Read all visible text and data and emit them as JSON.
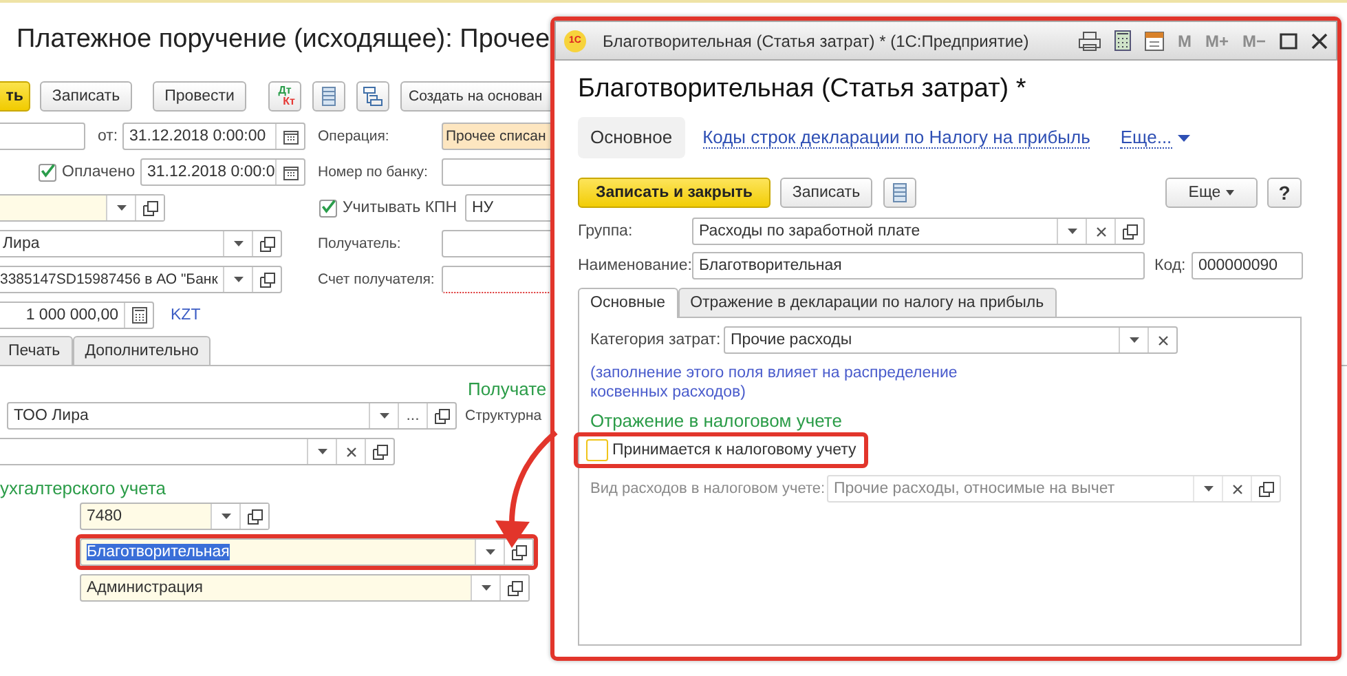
{
  "main_form": {
    "title": "Платежное поручение (исходящее): Прочее",
    "toolbar": [
      {
        "kind": "primary",
        "label": "ть"
      },
      {
        "kind": "button",
        "label": "Записать"
      },
      {
        "kind": "button",
        "label": "Провести"
      },
      {
        "kind": "dtkt",
        "top": "Дт",
        "bottom": "Кт"
      },
      {
        "kind": "list"
      },
      {
        "kind": "structure"
      },
      {
        "kind": "button",
        "label": "Создать на основан"
      }
    ],
    "date_label": "от:",
    "date": "31.12.2018  0:00:00",
    "operation": {
      "label": "Операция:",
      "value": "Прочее списан"
    },
    "paid": {
      "label": "Оплачено",
      "checked": true,
      "date": "31.12.2018  0:00:0"
    },
    "bank_number_label": "Номер по банку:",
    "kpn": {
      "label": "Учитывать КПН",
      "checked": true,
      "value": "НУ"
    },
    "counterparty": "Лира",
    "recipient_label": "Получатель:",
    "account": "3385147SD15987456 в АО \"Банк",
    "recipient_account_label": "Счет получателя:",
    "amount": "1 000 000,00",
    "currency": "KZT",
    "tabs": [
      {
        "label": "Печать",
        "selected": false
      },
      {
        "label": "Дополнительно",
        "selected": false
      }
    ],
    "recipient_section": "Получате",
    "org": {
      "value": "ТОО Лира",
      "more": "..."
    },
    "structure_label": "Структурна",
    "accounting_section": "ухгалтерского учета",
    "account_rows": [
      {
        "value": "7480",
        "selected": false,
        "annotated": false
      },
      {
        "value": "Благотворительная",
        "selected": true,
        "annotated": true
      },
      {
        "value": "Администрация",
        "selected": false,
        "annotated": false
      }
    ]
  },
  "dialog": {
    "logo": "1С",
    "window_title": "Благотворительная (Статья затрат) *  (1С:Предприятие)",
    "memory_buttons": [
      "M",
      "M+",
      "M−"
    ],
    "heading": "Благотворительная (Статья затрат) *",
    "nav": [
      {
        "label": "Основное",
        "selected": true
      },
      {
        "label": "Коды строк декларации по Налогу на прибыль",
        "selected": false
      }
    ],
    "more_link": "Еще...",
    "save_close": "Записать и закрыть",
    "save": "Записать",
    "more_button": "Еще",
    "help": "?",
    "group": {
      "label": "Группа:",
      "value": "Расходы по заработной плате"
    },
    "name": {
      "label": "Наименование:",
      "value": "Благотворительная"
    },
    "code": {
      "label": "Код:",
      "value": "000000090"
    },
    "tabs": [
      {
        "label": "Основные",
        "selected": true
      },
      {
        "label": "Отражение в декларации по налогу на прибыль",
        "selected": false
      }
    ],
    "category": {
      "label": "Категория затрат:",
      "value": "Прочие расходы"
    },
    "note": "(заполнение этого поля влияет на распределение косвенных расходов)",
    "tax_section": "Отражение в налоговом учете",
    "tax_accepted": {
      "label": "Принимается к налоговому учету",
      "checked": false,
      "annotated": true
    },
    "expense_kind": {
      "label": "Вид расходов в налоговом учете:",
      "value": "Прочие расходы, относимые на вычет",
      "disabled": true
    }
  }
}
